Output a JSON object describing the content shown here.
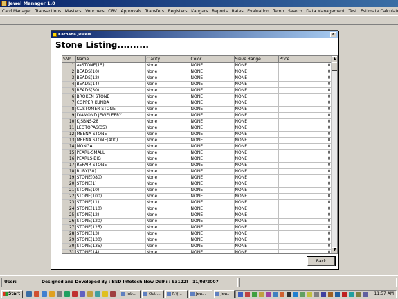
{
  "app": {
    "title": "Jewel Manager 1.0"
  },
  "menu": [
    "Card Manager",
    "Transactions",
    "Masters",
    "Vouchers",
    "ORV",
    "Approvals",
    "Transfers",
    "Registers",
    "Kangars",
    "Reports",
    "Rates",
    "Evaluation",
    "Temp",
    "Search",
    "Data Management",
    "Test",
    "Estimate Calculator"
  ],
  "dialog": {
    "title": "Kathana Jewels......",
    "close_glyph": "✕",
    "heading": "Stone Listing..........",
    "columns": [
      "SNo.",
      "Name",
      "Clarity",
      "Color",
      "Sieve Range",
      "Price"
    ],
    "rows": [
      [
        "1",
        "aaSTONE(15)",
        "None",
        "NONE",
        "NONE",
        "0"
      ],
      [
        "2",
        "BEADS(10)",
        "None",
        "NONE",
        "NONE",
        "0"
      ],
      [
        "3",
        "BEADS(12)",
        "None",
        "NONE",
        "NONE",
        "0"
      ],
      [
        "4",
        "BEADS(14)",
        "None",
        "NONE",
        "NONE",
        "0"
      ],
      [
        "5",
        "BEADS(30)",
        "None",
        "NONE",
        "NONE",
        "0"
      ],
      [
        "6",
        "BROKEN STONE",
        "None",
        "NONE",
        "NONE",
        "0"
      ],
      [
        "7",
        "COPPER KUNDA",
        "None",
        "NONE",
        "NONE",
        "0"
      ],
      [
        "8",
        "CUSTOMER STONE",
        "None",
        "NONE",
        "NONE",
        "0"
      ],
      [
        "9",
        "DIAMOND JEWELEERY",
        "None",
        "NONE",
        "NONE",
        "0"
      ],
      [
        "10",
        "KJSBNS-28",
        "None",
        "NONE",
        "NONE",
        "0"
      ],
      [
        "11",
        "LEOTOPAS(35)",
        "None",
        "NONE",
        "NONE",
        "0"
      ],
      [
        "12",
        "MEENA STONE",
        "None",
        "NONE",
        "NONE",
        "0"
      ],
      [
        "13",
        "MEENA STONE(400)",
        "None",
        "NONE",
        "NONE",
        "0"
      ],
      [
        "14",
        "MONGA",
        "None",
        "NONE",
        "NONE",
        "0"
      ],
      [
        "15",
        "PEARL-SMALL",
        "None",
        "NONE",
        "NONE",
        "0"
      ],
      [
        "16",
        "PEARLS-BIG",
        "None",
        "NONE",
        "NONE",
        "0"
      ],
      [
        "17",
        "REPAIR STONE",
        "None",
        "NONE",
        "NONE",
        "0"
      ],
      [
        "18",
        "RUBY(30)",
        "None",
        "NONE",
        "NONE",
        "0"
      ],
      [
        "19",
        "STONE(080)",
        "None",
        "NONE",
        "NONE",
        "0"
      ],
      [
        "20",
        "STONE(1)",
        "None",
        "NONE",
        "NONE",
        "0"
      ],
      [
        "21",
        "STONE(10)",
        "None",
        "NONE",
        "NONE",
        "0"
      ],
      [
        "22",
        "STONE(100)",
        "None",
        "NONE",
        "NONE",
        "0"
      ],
      [
        "23",
        "STONE(11)",
        "None",
        "NONE",
        "NONE",
        "0"
      ],
      [
        "24",
        "STONE(110)",
        "None",
        "NONE",
        "NONE",
        "0"
      ],
      [
        "25",
        "STONE(12)",
        "None",
        "NONE",
        "NONE",
        "0"
      ],
      [
        "26",
        "STONE(120)",
        "None",
        "NONE",
        "NONE",
        "0"
      ],
      [
        "27",
        "STONE(125)",
        "None",
        "NONE",
        "NONE",
        "0"
      ],
      [
        "28",
        "STONE(13)",
        "None",
        "NONE",
        "NONE",
        "0"
      ],
      [
        "29",
        "STONE(130)",
        "None",
        "NONE",
        "NONE",
        "0"
      ],
      [
        "30",
        "STONE(135)",
        "None",
        "NONE",
        "NONE",
        "0"
      ],
      [
        "31",
        "STONE(14)",
        "None",
        "NONE",
        "NONE",
        "0"
      ]
    ],
    "scroll_up": "▲",
    "scroll_down": "▼",
    "back_label": "Back"
  },
  "statusbar": {
    "user_label": "User:",
    "credit": "Designed and Developed By : BSD Infotech New Delhi : 9312289566",
    "date": "11/03/2007"
  },
  "taskbar": {
    "start_label": "Start",
    "tasks": [
      "Inb...",
      "Outl...",
      "F:\\(...",
      "Jew...",
      "Jew..."
    ],
    "clock": "11:57 AM"
  },
  "colors": {
    "title_blue": "#0a246a",
    "face": "#d4d0c8"
  }
}
